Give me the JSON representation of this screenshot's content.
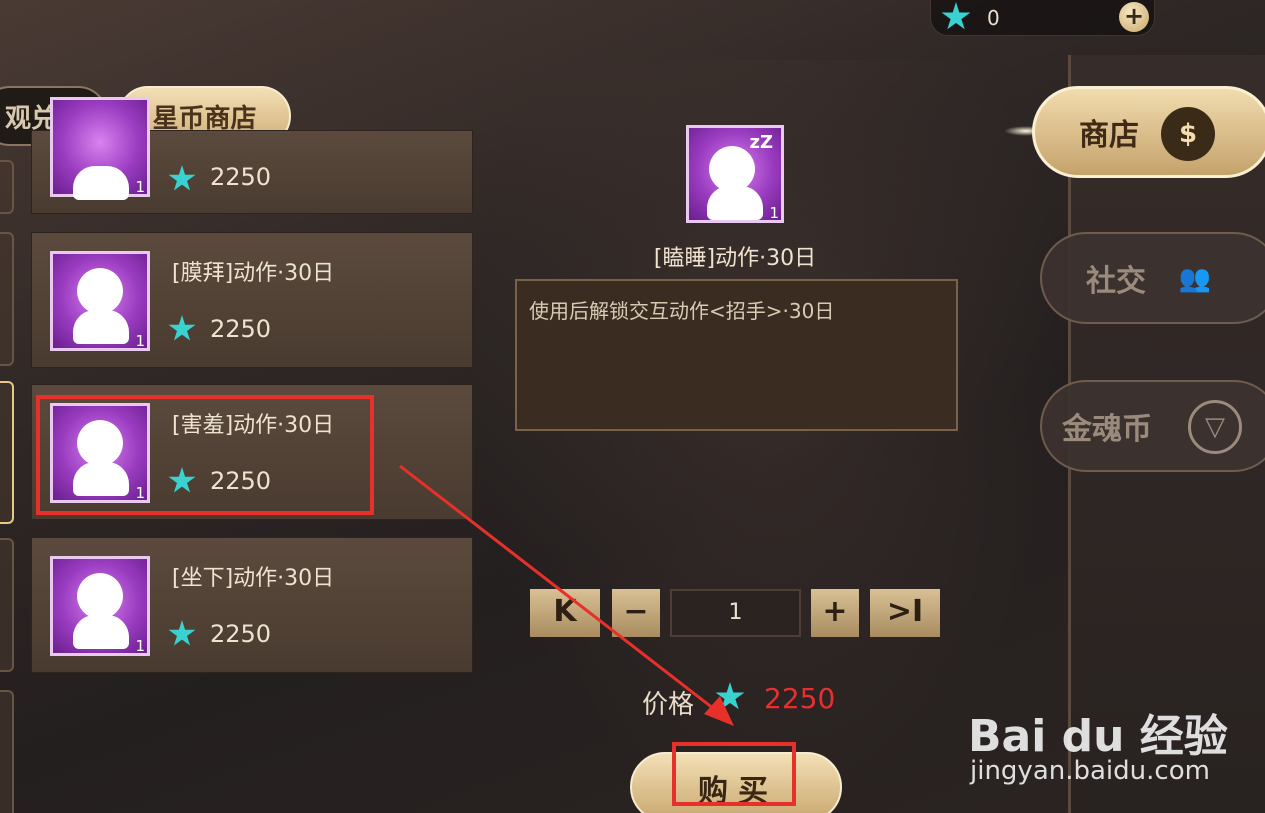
{
  "currency": {
    "amount": "0",
    "add_icon": "plus-icon"
  },
  "tabs": [
    {
      "label": "观兑换",
      "selected": false
    },
    {
      "label": "星币商店",
      "selected": true
    }
  ],
  "items": [
    {
      "name": "",
      "price": "2250",
      "qty": "1",
      "icon": "emote-icon"
    },
    {
      "name": "[膜拜]动作·30日",
      "price": "2250",
      "qty": "1",
      "icon": "worship-emote-icon"
    },
    {
      "name": "[害羞]动作·30日",
      "price": "2250",
      "qty": "1",
      "icon": "shy-emote-icon",
      "highlighted": true
    },
    {
      "name": "[坐下]动作·30日",
      "price": "2250",
      "qty": "1",
      "icon": "sit-emote-icon"
    }
  ],
  "detail": {
    "name": "[瞌睡]动作·30日",
    "qty": "1",
    "description": "使用后解锁交互动作<招手>·30日",
    "quantity": "1",
    "price_label": "价格",
    "price": "2250",
    "buy_label": "购买"
  },
  "sidebar": [
    {
      "label": "商店",
      "icon": "money-bag-icon",
      "icon_glyph": "$",
      "selected": true
    },
    {
      "label": "社交",
      "icon": "people-icon",
      "icon_glyph": "👥",
      "selected": false
    },
    {
      "label": "金魂币",
      "icon": "emblem-icon",
      "icon_glyph": "▽",
      "selected": false
    }
  ],
  "watermark": {
    "logo": "Bai du 经验",
    "url": "jingyan.baidu.com"
  },
  "colors": {
    "highlight_box": "#e8302a",
    "price": "#e63030",
    "star": "#39d2d0"
  }
}
